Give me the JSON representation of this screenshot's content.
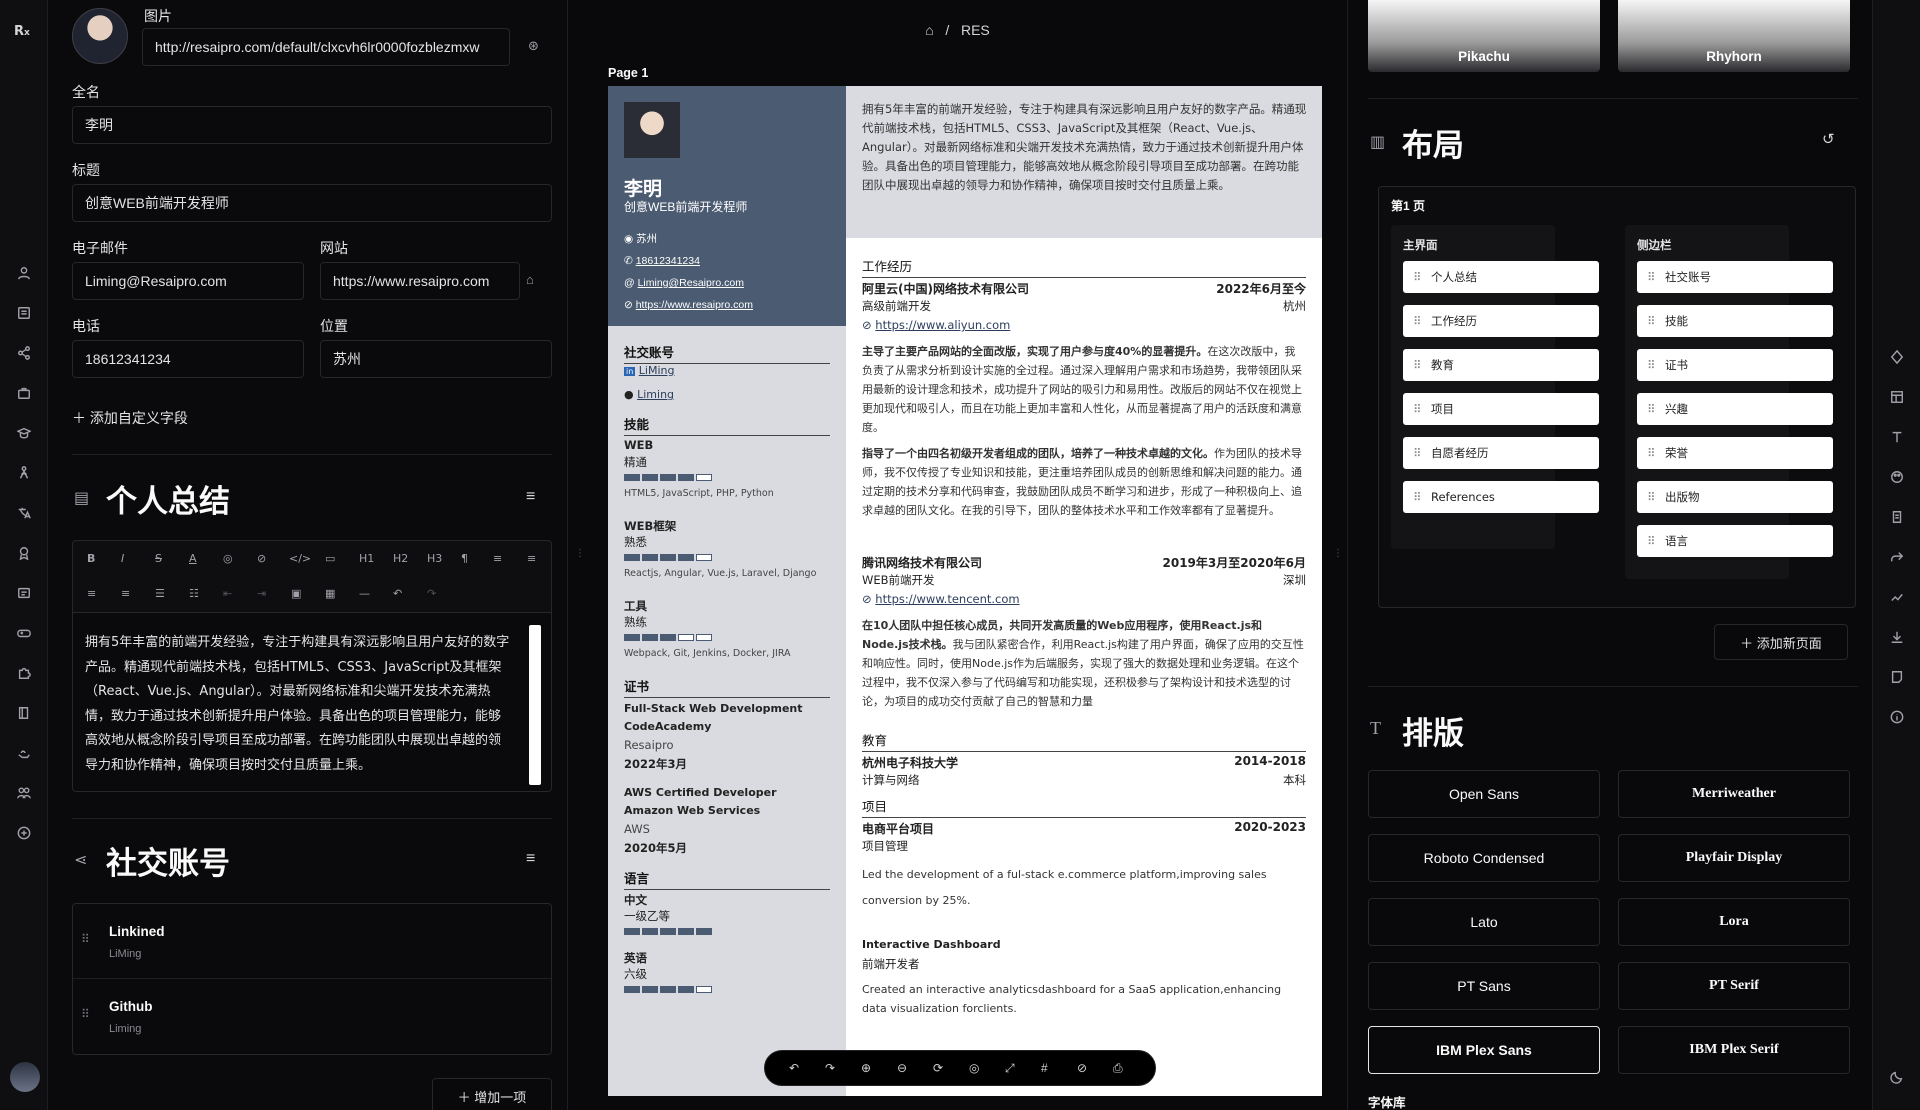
{
  "left": {
    "photo_label": "图片",
    "photo_url": "http://resaipro.com/default/clxcvh6lr0000fozblezmxw",
    "fullname_label": "全名",
    "fullname": "李明",
    "headline_label": "标题",
    "headline": "创意WEB前端开发程师",
    "email_label": "电子邮件",
    "email": "Liming@Resaipro.com",
    "website_label": "网站",
    "website": "https://www.resaipro.com",
    "phone_label": "电话",
    "phone": "18612341234",
    "location_label": "位置",
    "location": "苏州",
    "add_custom": "添加自定义字段",
    "summary_title": "个人总结",
    "summary_text": "拥有5年丰富的前端开发经验，专注于构建具有深远影响且用户友好的数字产品。精通现代前端技术栈，包括HTML5、CSS3、JavaScript及其框架（React、Vue.js、Angular）。对最新网络标准和尖端开发技术充满热情，致力于通过技术创新提升用户体验。具备出色的项目管理能力，能够高效地从概念阶段引导项目至成功部署。在跨功能团队中展现出卓越的领导力和协作精神，确保项目按时交付且质量上乘。",
    "social_title": "社交账号",
    "social_items": [
      {
        "network": "Linkined",
        "user": "LiMing"
      },
      {
        "network": "Github",
        "user": "Liming"
      }
    ],
    "add_item": "增加一项",
    "toolbar": {
      "h1": "H1",
      "h2": "H2",
      "h3": "H3"
    }
  },
  "center": {
    "breadcrumb_sep": "/",
    "breadcrumb": "RES",
    "page_label": "Page 1",
    "resume": {
      "name": "李明",
      "headline": "创意WEB前端开发程师",
      "location": "苏州",
      "phone": "18612341234",
      "email": "Liming@Resaipro.com",
      "website": "https://www.resaipro.com",
      "summary": "拥有5年丰富的前端开发经验，专注于构建具有深远影响且用户友好的数字产品。精通现代前端技术栈，包括HTML5、CSS3、JavaScript及其框架（React、Vue.js、Angular）。对最新网络标准和尖端开发技术充满热情，致力于通过技术创新提升用户体验。具备出色的项目管理能力，能够高效地从概念阶段引导项目至成功部署。在跨功能团队中展现出卓越的领导力和协作精神，确保项目按时交付且质量上乘。",
      "social_h": "社交账号",
      "social": [
        {
          "user": "LiMing"
        },
        {
          "user": "Liming"
        }
      ],
      "skills_h": "技能",
      "skills": [
        {
          "name": "WEB",
          "level": "精通",
          "stars": 4,
          "kw": "HTML5, JavaScript, PHP, Python"
        },
        {
          "name": "WEB框架",
          "level": "熟悉",
          "stars": 4,
          "kw": "Reactjs, Angular, Vue.js, Laravel, Django"
        },
        {
          "name": "工具",
          "level": "熟练",
          "stars": 3,
          "kw": "Webpack, Git, Jenkins, Docker, JIRA"
        }
      ],
      "cert_h": "证书",
      "certs": [
        {
          "name": "Full-Stack Web Development CodeAcademy",
          "issuer": "Resaipro",
          "date": "2022年3月"
        },
        {
          "name": "AWS Certified Developer Amazon Web Services",
          "issuer": "AWS",
          "date": "2020年5月"
        }
      ],
      "lang_h": "语言",
      "langs": [
        {
          "name": "中文",
          "level": "一级乙等",
          "stars": 5
        },
        {
          "name": "英语",
          "level": "六级",
          "stars": 4
        }
      ],
      "exp_h": "工作经历",
      "exp": [
        {
          "company": "阿里云(中国)网络技术有限公司",
          "date": "2022年6月至今",
          "role": "高级前端开发",
          "city": "杭州",
          "url": "https://www.aliyun.com",
          "p1b": "主导了主要产品网站的全面改版，实现了用户参与度40%的显著提升。",
          "p1": "在这次改版中，我负责了从需求分析到设计实施的全过程。通过深入理解用户需求和市场趋势，我带领团队采用最新的设计理念和技术，成功提升了网站的吸引力和易用性。改版后的网站不仅在视觉上更加现代和吸引人，而且在功能上更加丰富和人性化，从而显著提高了用户的活跃度和满意度。",
          "p2b": "指导了一个由四名初级开发者组成的团队，培养了一种技术卓越的文化。",
          "p2": "作为团队的技术导师，我不仅传授了专业知识和技能，更注重培养团队成员的创新思维和解决问题的能力。通过定期的技术分享和代码审查，我鼓励团队成员不断学习和进步，形成了一种积极向上、追求卓越的团队文化。在我的引导下，团队的整体技术水平和工作效率都有了显著提升。"
        },
        {
          "company": "腾讯网络技术有限公司",
          "date": "2019年3月至2020年6月",
          "role": "WEB前端开发",
          "city": "深圳",
          "url": "https://www.tencent.com",
          "p1b": "在10人团队中担任核心成员，共同开发高质量的Web应用程序，使用React.js和Node.js技术栈。",
          "p1": "我与团队紧密合作，利用React.js构建了用户界面，确保了应用的交互性和响应性。同时，使用Node.js作为后端服务，实现了强大的数据处理和业务逻辑。在这个过程中，我不仅深入参与了代码编写和功能实现，还积极参与了架构设计和技术选型的讨论，为项目的成功交付贡献了自己的智慧和力量"
        }
      ],
      "edu_h": "教育",
      "edu": {
        "school": "杭州电子科技大学",
        "date": "2014-2018",
        "major": "计算与网络",
        "degree": "本科"
      },
      "proj_h": "项目",
      "proj": [
        {
          "name": "电商平台项目",
          "date": "2020-2023",
          "role": "项目管理",
          "desc": "Led the development of a ful-stack e.commerce platform,improving sales conversion by 25%."
        },
        {
          "name": "Interactive Dashboard",
          "date": "",
          "role": "前端开发者",
          "desc": "Created an interactive analyticsdashboard for a SaaS application,enhancing data visualization forclients."
        }
      ]
    }
  },
  "right": {
    "templates": [
      {
        "name": "Pikachu"
      },
      {
        "name": "Rhyhorn"
      }
    ],
    "layout_title": "布局",
    "page_label": "第1 页",
    "main_label": "主界面",
    "sidebar_label": "侧边栏",
    "main_items": [
      "个人总结",
      "工作经历",
      "教育",
      "项目",
      "自愿者经历",
      "References"
    ],
    "sidebar_items": [
      "社交账号",
      "技能",
      "证书",
      "兴趣",
      "荣誉",
      "出版物",
      "语言"
    ],
    "add_page": "添加新页面",
    "typo_title": "排版",
    "fonts": [
      "Open Sans",
      "Merriweather",
      "Roboto Condensed",
      "Playfair Display",
      "Lato",
      "Lora",
      "PT Sans",
      "PT Serif",
      "IBM Plex Sans",
      "IBM Plex Serif"
    ],
    "selected_font": "IBM Plex Sans",
    "font_lib": "字体库"
  }
}
